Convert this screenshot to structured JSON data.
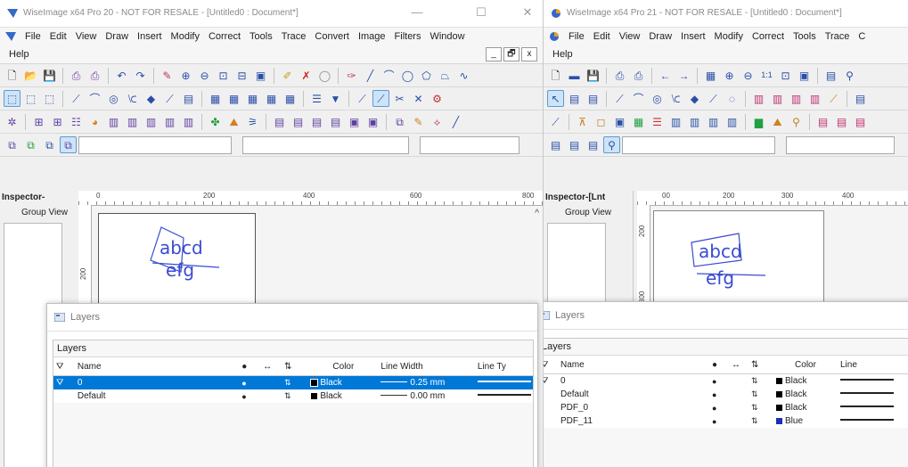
{
  "left": {
    "title": "WiseImage x64 Pro 20 - NOT FOR RESALE - [Untitled0 : Document*]",
    "window_buttons": [
      "—",
      "☐",
      "✕"
    ],
    "menu": [
      "File",
      "Edit",
      "View",
      "Draw",
      "Insert",
      "Modify",
      "Correct",
      "Tools",
      "Trace",
      "Convert",
      "Image",
      "Filters",
      "Window"
    ],
    "help": "Help",
    "mdi_buttons": [
      "_",
      "🗗",
      "x"
    ],
    "inspector_title": "Inspector-",
    "group_view": "Group View",
    "ruler_h": [
      "0",
      "200",
      "400",
      "600",
      "800"
    ],
    "ruler_v": [
      "200"
    ],
    "drawing": {
      "line1": "abcd",
      "line2": "efg"
    },
    "layers": {
      "title": "Layers",
      "section_label": "Layers",
      "headers": [
        "Name",
        "Color",
        "Line Width",
        "Line Ty"
      ],
      "rows": [
        {
          "name": "0",
          "color": "Black",
          "swatch": "#000000",
          "width": "0.25 mm",
          "selected": true
        },
        {
          "name": "Default",
          "color": "Black",
          "swatch": "#000000",
          "width": "0.00 mm",
          "selected": false
        }
      ]
    }
  },
  "right": {
    "title": "WiseImage x64 Pro 21 - NOT FOR RESALE - [Untitled0 : Document*]",
    "menu": [
      "File",
      "Edit",
      "View",
      "Draw",
      "Insert",
      "Modify",
      "Correct",
      "Tools",
      "Trace",
      "C"
    ],
    "help": "Help",
    "inspector_title": "Inspector-[Lnt",
    "group_view": "Group View",
    "ruler_h": [
      "00",
      "200",
      "300",
      "400"
    ],
    "ruler_v": [
      "200",
      "300"
    ],
    "drawing": {
      "line1": "abcd",
      "line2": "efg"
    },
    "layers": {
      "title": "Layers",
      "section_label": "Layers",
      "headers": [
        "Name",
        "Color",
        "Line"
      ],
      "rows": [
        {
          "name": "0",
          "color": "Black",
          "swatch": "#000000"
        },
        {
          "name": "Default",
          "color": "Black",
          "swatch": "#000000"
        },
        {
          "name": "PDF_0",
          "color": "Black",
          "swatch": "#000000"
        },
        {
          "name": "PDF_11",
          "color": "Blue",
          "swatch": "#1c2fb5"
        }
      ]
    }
  },
  "colors": {
    "accent": "#0078d7",
    "drawing": "#3a4bd1",
    "selection": "#cde4f7"
  }
}
